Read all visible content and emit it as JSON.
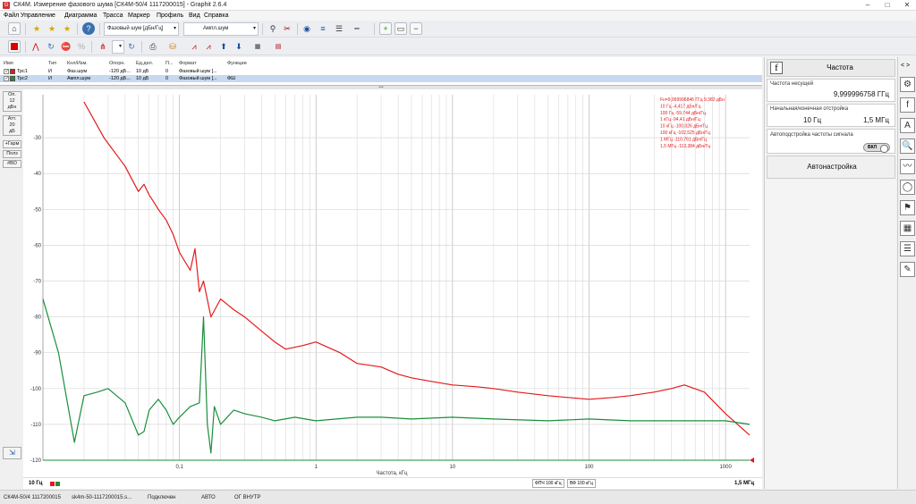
{
  "window": {
    "title": "СК4М. Измерение фазового шума [СК4М-50/4 1117200015] - Graphit 2.6.4"
  },
  "menu": [
    "Файл",
    "Управление",
    "Диаграмма",
    "Трасса",
    "Маркер",
    "Профиль",
    "Вид",
    "Справка"
  ],
  "toolbar": {
    "meas_mode": "Фазовый шум [дБн/Гц]",
    "scale_mode": "Ампл.шум",
    "icons": [
      "home-icon",
      "star-icon",
      "star-add-icon",
      "star-list-icon",
      "help-icon",
      "refresh-icon",
      "calibrate-icon",
      "clear-icon",
      "eye-icon",
      "lines-icon",
      "dashes-icon",
      "stop-icon",
      "spectrum-icon",
      "autoset-icon",
      "delete-icon",
      "print-icon",
      "save-icon",
      "markers-icon",
      "export-icon",
      "import-icon"
    ]
  },
  "table": {
    "headers": [
      "Имя",
      "Тип",
      "Кнл/Изм.",
      "Опорн.",
      "Ед.дел.",
      "П...",
      "Формат",
      "Функции"
    ],
    "rows": [
      {
        "name": "Трс1",
        "color": "#e41a1c",
        "type": "И",
        "meas": "Фаз.шум",
        "ref": "-120 дБ...",
        "scale": "10 дБ",
        "p": "0",
        "format": "Фазовый шум [...",
        "func": ""
      },
      {
        "name": "Трс2",
        "color": "#1a8f3a",
        "type": "И",
        "meas": "Ампл.шум",
        "ref": "-120 дБ...",
        "scale": "10 дБ",
        "p": "0",
        "format": "Фазовый шум [...",
        "func": "ФШ"
      }
    ]
  },
  "leftbar": [
    {
      "t1": "Оп.",
      "t2": "12",
      "t3": "дБн"
    },
    {
      "t1": "Атт.",
      "t2": "20",
      "t3": "дБ"
    },
    {
      "t1": "+Гарм"
    },
    {
      "t1": "Полз"
    },
    {
      "t1": "#ВО"
    }
  ],
  "chart_data": {
    "type": "line",
    "xlabel": "Частота, кГц",
    "x_scale": "log",
    "xlim": [
      0.01,
      1500
    ],
    "ylim": [
      -120,
      -18
    ],
    "y_ticks": [
      -30,
      -40,
      -50,
      -60,
      -70,
      -80,
      -90,
      -100,
      -110,
      -120
    ],
    "x_ticks": [
      {
        "v": 0.1,
        "label": "0,1"
      },
      {
        "v": 1,
        "label": "1"
      },
      {
        "v": 10,
        "label": "10"
      },
      {
        "v": 100,
        "label": "100"
      },
      {
        "v": 1000,
        "label": "1000"
      }
    ],
    "start_label": "10 Гц",
    "stop_label": "1,5 МГц",
    "series": [
      {
        "color": "#e41a1c",
        "x": [
          0.02,
          0.028,
          0.04,
          0.05,
          0.055,
          0.06,
          0.065,
          0.07,
          0.08,
          0.09,
          0.1,
          0.12,
          0.13,
          0.14,
          0.15,
          0.17,
          0.2,
          0.25,
          0.3,
          0.4,
          0.5,
          0.6,
          0.8,
          1,
          1.5,
          2,
          3,
          4,
          5,
          7,
          10,
          15,
          20,
          30,
          50,
          70,
          100,
          150,
          200,
          300,
          400,
          500,
          700,
          1000,
          1500
        ],
        "y": [
          -20,
          -30,
          -38,
          -45,
          -43,
          -46,
          -48,
          -50,
          -53,
          -57,
          -62,
          -67,
          -61,
          -73,
          -70,
          -80,
          -75,
          -78,
          -80,
          -84,
          -87,
          -89,
          -88,
          -87,
          -90,
          -93,
          -94,
          -96,
          -97,
          -98,
          -99,
          -99.5,
          -100,
          -101,
          -102,
          -102.5,
          -103,
          -102.5,
          -102,
          -101,
          -100,
          -99,
          -101,
          -107,
          -113
        ]
      },
      {
        "color": "#1a8f3a",
        "x": [
          0.01,
          0.013,
          0.017,
          0.02,
          0.025,
          0.03,
          0.04,
          0.05,
          0.055,
          0.06,
          0.07,
          0.08,
          0.09,
          0.1,
          0.12,
          0.14,
          0.15,
          0.16,
          0.17,
          0.18,
          0.2,
          0.25,
          0.3,
          0.4,
          0.5,
          0.7,
          1,
          2,
          3,
          5,
          10,
          20,
          50,
          100,
          200,
          500,
          1000,
          1500
        ],
        "y": [
          -75,
          -90,
          -115,
          -102,
          -101,
          -100,
          -104,
          -113,
          -112,
          -106,
          -103,
          -106,
          -110,
          -108,
          -105,
          -104,
          -80,
          -110,
          -118,
          -105,
          -110,
          -106,
          -107,
          -108,
          -109,
          -108,
          -109,
          -108,
          -108,
          -108.5,
          -108,
          -108.5,
          -109,
          -108.5,
          -109,
          -109,
          -109,
          -110
        ]
      }
    ],
    "annotation": [
      "Fн=9,999996846 ГГц  9,382 дБн",
      "10 Гц      -4,417 дБн/Гц",
      "100 Гц    -59,744 дБн/Гц",
      "1 кГц      -94,41 дБн/Гц",
      "10 кГц    -100,026 дБн/Гц",
      "100 кГц   -102,525 дБн/Гц",
      "1 МГц     -110,761 дБн/Гц",
      "1,5 МГц   -113,384 дБн/Гц"
    ]
  },
  "plot_strip": {
    "start": "10 Гц",
    "stop": "1,5 МГц",
    "tag1": "ФПЧ 100 кГц",
    "tag2": "ВФ 100 кГц"
  },
  "right_panel": {
    "header": "Частота",
    "carrier_label": "Частота несущей",
    "carrier_value": "9,999996758 ГГц",
    "span_label": "Начальная/конечная отстройка",
    "span_start": "10 Гц",
    "span_stop": "1,5 МГц",
    "auto_label": "Автоподстройка частоты сигнала",
    "auto_toggle": "ВКЛ",
    "autoset": "Автонастройка"
  },
  "vtoolbar": [
    {
      "name": "settings-icon",
      "g": "⚙"
    },
    {
      "name": "function-icon",
      "g": "f"
    },
    {
      "name": "text-icon",
      "g": "A"
    },
    {
      "name": "zoom-icon",
      "g": "🔍"
    },
    {
      "name": "trace-icon",
      "g": "〰"
    },
    {
      "name": "cycle-icon",
      "g": "◯"
    },
    {
      "name": "flag-icon",
      "g": "⚑"
    },
    {
      "name": "marker-chart-icon",
      "g": "▦"
    },
    {
      "name": "sliders-icon",
      "g": "☰"
    },
    {
      "name": "tools-icon",
      "g": "✎"
    }
  ],
  "status": [
    "СК4М-50/4 1117200015",
    "sk4m-50-1117200015.s...",
    "Подключен",
    "АВТО",
    "ОГ ВНУТР"
  ]
}
